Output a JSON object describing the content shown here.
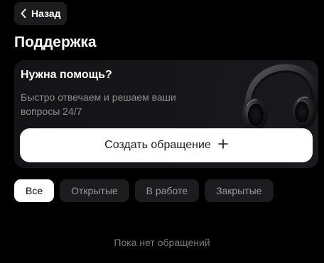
{
  "header": {
    "back_label": "Назад"
  },
  "page": {
    "title": "Поддержка"
  },
  "help_card": {
    "title": "Нужна помощь?",
    "subtitle": "Быстро отвечаем и решаем ваши вопросы 24/7",
    "create_label": "Создать обращение",
    "image_icon": "headphones-icon"
  },
  "filters": [
    {
      "label": "Все",
      "active": true
    },
    {
      "label": "Открытые",
      "active": false
    },
    {
      "label": "В работе",
      "active": false
    },
    {
      "label": "Закрытые",
      "active": false
    }
  ],
  "empty_state": {
    "text": "Пока нет обращений"
  },
  "colors": {
    "background": "#000000",
    "surface": "#1c1c1e",
    "primary_button": "#ffffff",
    "muted_text": "#8e8e93"
  }
}
